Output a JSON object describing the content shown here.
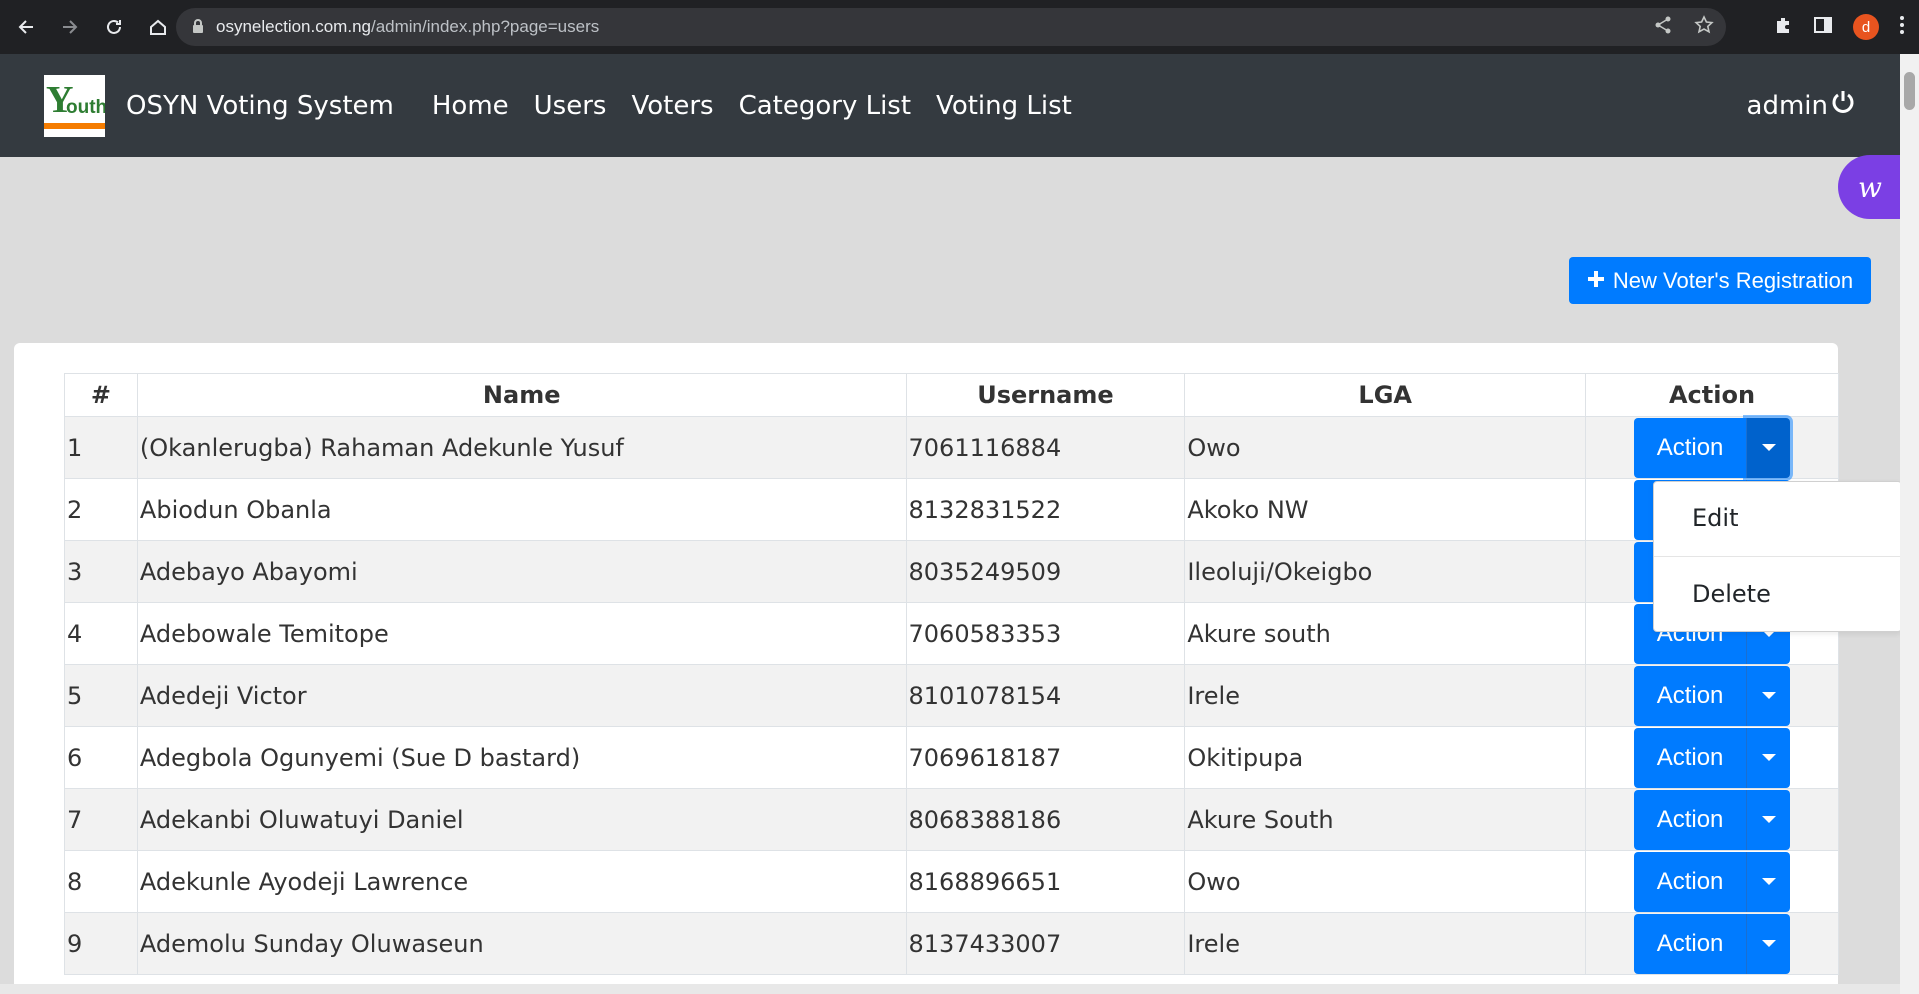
{
  "browser": {
    "url_host": "osynelection.com.ng",
    "url_path": "/admin/index.php?page=users",
    "profile_initial": "d"
  },
  "navbar": {
    "brand": "OSYN Voting System",
    "menu": [
      "Home",
      "Users",
      "Voters",
      "Category List",
      "Voting List"
    ],
    "user": "admin"
  },
  "toolbar": {
    "new_button_label": "New Voter's Registration"
  },
  "table": {
    "headers": [
      "#",
      "Name",
      "Username",
      "LGA",
      "Action"
    ],
    "rows": [
      {
        "num": "1",
        "name": "(Okanlerugba) Rahaman Adekunle Yusuf",
        "username": "7061116884",
        "lga": "Owo"
      },
      {
        "num": "2",
        "name": "Abiodun Obanla",
        "username": "8132831522",
        "lga": "Akoko NW"
      },
      {
        "num": "3",
        "name": "Adebayo Abayomi",
        "username": "8035249509",
        "lga": "Ileoluji/Okeigbo"
      },
      {
        "num": "4",
        "name": "Adebowale Temitope",
        "username": "7060583353",
        "lga": "Akure south"
      },
      {
        "num": "5",
        "name": "Adedeji Victor",
        "username": "8101078154",
        "lga": "Irele"
      },
      {
        "num": "6",
        "name": "Adegbola Ogunyemi (Sue D bastard)",
        "username": "7069618187",
        "lga": "Okitipupa"
      },
      {
        "num": "7",
        "name": "Adekanbi Oluwatuyi Daniel",
        "username": "8068388186",
        "lga": "Akure South"
      },
      {
        "num": "8",
        "name": "Adekunle Ayodeji Lawrence",
        "username": "8168896651",
        "lga": "Owo"
      },
      {
        "num": "9",
        "name": "Ademolu Sunday Oluwaseun",
        "username": "8137433007",
        "lga": "Irele"
      }
    ],
    "action_label": "Action"
  },
  "dropdown": {
    "items": [
      "Edit",
      "Delete"
    ]
  },
  "colors": {
    "primary": "#007bff",
    "navbar": "#343a40",
    "widget": "#7b3fe4"
  }
}
